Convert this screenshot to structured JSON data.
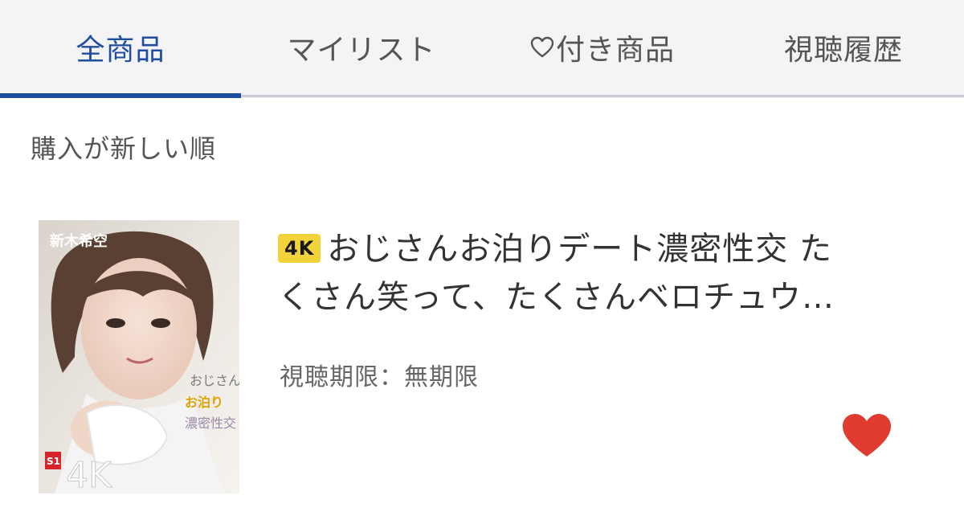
{
  "tabs": [
    {
      "label": "全商品",
      "active": true
    },
    {
      "label": "マイリスト",
      "active": false
    },
    {
      "label": "付き商品",
      "active": false,
      "icon": "heart-outline-icon"
    },
    {
      "label": "視聴履歴",
      "active": false
    }
  ],
  "sort": {
    "label": "購入が新しい順"
  },
  "product": {
    "badge": "4K",
    "title_line1": "おじさんお泊りデート濃密性交 た",
    "title_line2": "くさん笑って、たくさんベロチュウ…",
    "expiry": "視聴期限：無期限",
    "favorite": true,
    "thumbnail": {
      "actress_name": "新木希空",
      "logo": "S1",
      "overlay_text": "4K",
      "side_text": [
        "おじさん",
        "お泊り",
        "濃密性交"
      ]
    }
  },
  "colors": {
    "accent": "#1f4da0",
    "tabbar_bg": "#f4f4f6",
    "badge": "#f2d43a",
    "heart": "#e03b2f",
    "logo_red": "#d8232a"
  }
}
